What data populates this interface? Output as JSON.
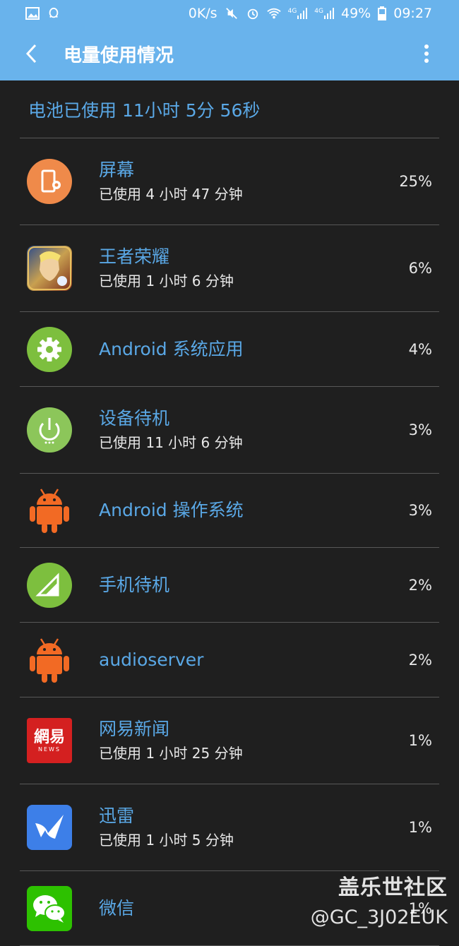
{
  "status_bar": {
    "speed": "0K/s",
    "signal_label_1": "4G",
    "signal_label_2": "4G",
    "battery": "49%",
    "time": "09:27"
  },
  "app_bar": {
    "title": "电量使用情况"
  },
  "summary": {
    "text": "电池已使用 11小时 5分 56秒"
  },
  "items": [
    {
      "name": "屏幕",
      "sub": "已使用 4 小时 47 分钟",
      "pct": "25%",
      "icon": "screen-icon"
    },
    {
      "name": "王者荣耀",
      "sub": "已使用 1 小时 6 分钟",
      "pct": "6%",
      "icon": "honor-of-kings-icon"
    },
    {
      "name": "Android 系统应用",
      "sub": "",
      "pct": "4%",
      "icon": "android-system-gear-icon"
    },
    {
      "name": "设备待机",
      "sub": "已使用 11 小时 6 分钟",
      "pct": "3%",
      "icon": "device-standby-icon"
    },
    {
      "name": "Android 操作系统",
      "sub": "",
      "pct": "3%",
      "icon": "android-robot-icon"
    },
    {
      "name": "手机待机",
      "sub": "",
      "pct": "2%",
      "icon": "cell-signal-icon"
    },
    {
      "name": "audioserver",
      "sub": "",
      "pct": "2%",
      "icon": "android-robot-icon"
    },
    {
      "name": "网易新闻",
      "sub": "已使用 1 小时 25 分钟",
      "pct": "1%",
      "icon": "netease-news-icon"
    },
    {
      "name": "迅雷",
      "sub": "已使用 1 小时 5 分钟",
      "pct": "1%",
      "icon": "xunlei-icon"
    },
    {
      "name": "微信",
      "sub": "",
      "pct": "1%",
      "icon": "wechat-icon"
    }
  ],
  "netease_logo_text": {
    "main": "網易",
    "small": "NEWS"
  },
  "watermark": {
    "line1": "盖乐世社区",
    "line2": "@GC_3J02EUK"
  }
}
